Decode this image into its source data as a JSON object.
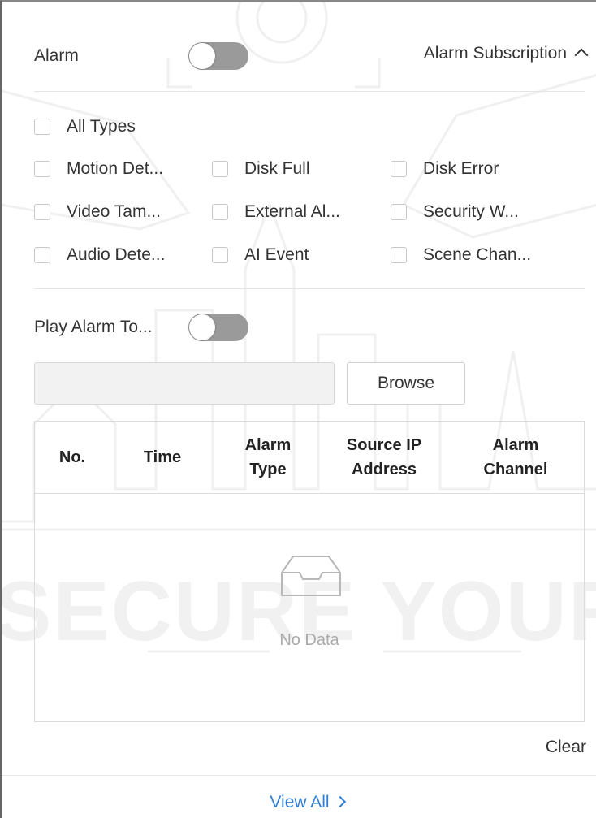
{
  "header": {
    "alarm_label": "Alarm",
    "alarm_toggle_on": false,
    "subscription_label": "Alarm Subscription"
  },
  "alarm_types": {
    "all_types": "All Types",
    "items": [
      "Motion Det...",
      "Disk Full",
      "Disk Error",
      "Video Tam...",
      "External Al...",
      "Security W...",
      "Audio Dete...",
      "AI Event",
      "Scene Chan..."
    ]
  },
  "play_tone": {
    "label": "Play Alarm To...",
    "toggle_on": false,
    "path_value": "",
    "browse_label": "Browse"
  },
  "table": {
    "columns": [
      "No.",
      "Time",
      "Alarm\nType",
      "Source IP\nAddress",
      "Alarm\nChannel"
    ],
    "empty_text": "No Data"
  },
  "clear_label": "Clear",
  "view_all_label": "View All",
  "watermark": {
    "text": "SECURE YOUR LIFE"
  },
  "colors": {
    "link": "#2f7fd8",
    "toggle_off": "#9a9a9a"
  }
}
